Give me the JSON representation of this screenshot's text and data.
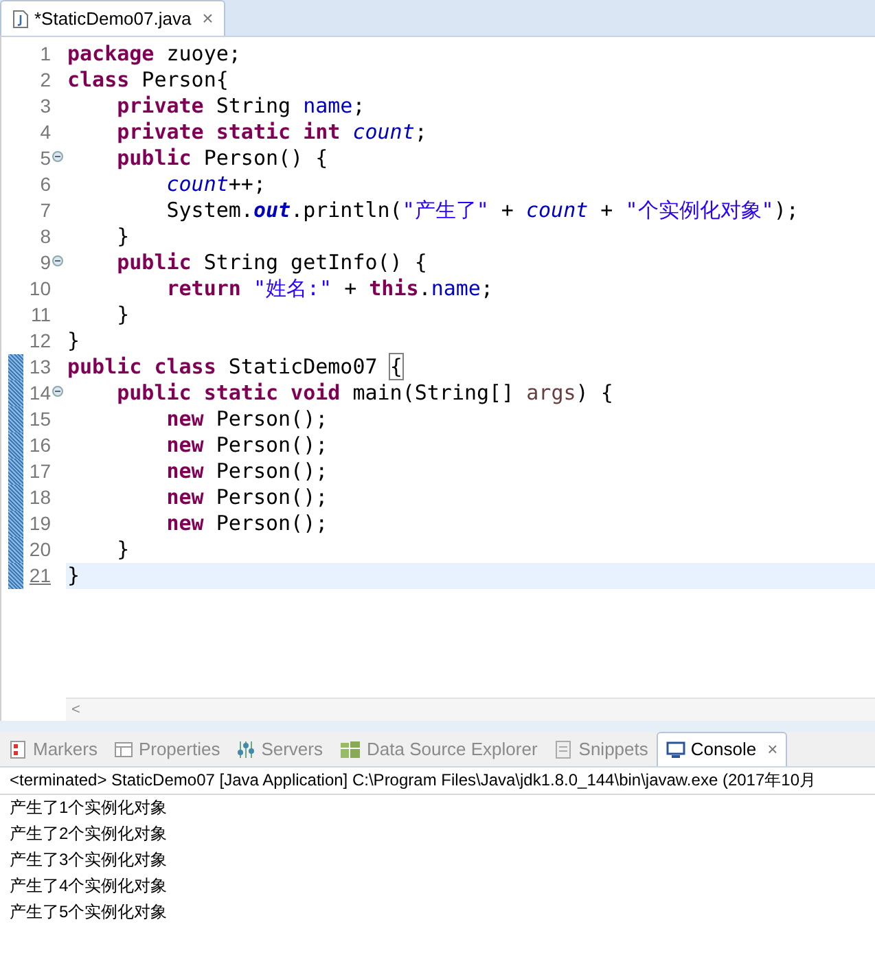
{
  "editor_tab": {
    "title": "*StaticDemo07.java",
    "close": "×"
  },
  "code_lines": [
    {
      "number": "1",
      "fold": false,
      "changed": false,
      "current": false,
      "tokens": [
        {
          "kind": "kw",
          "t": "package"
        },
        {
          "kind": "plain",
          "t": " zuoye;"
        }
      ]
    },
    {
      "number": "2",
      "fold": false,
      "changed": false,
      "current": false,
      "tokens": [
        {
          "kind": "kw",
          "t": "class"
        },
        {
          "kind": "plain",
          "t": " Person{"
        }
      ]
    },
    {
      "number": "3",
      "fold": false,
      "changed": false,
      "current": false,
      "tokens": [
        {
          "kind": "kw",
          "t": "    private"
        },
        {
          "kind": "plain",
          "t": " String "
        },
        {
          "kind": "field",
          "t": "name"
        },
        {
          "kind": "plain",
          "t": ";"
        }
      ]
    },
    {
      "number": "4",
      "fold": false,
      "changed": false,
      "current": false,
      "tokens": [
        {
          "kind": "kw",
          "t": "    private static int"
        },
        {
          "kind": "static",
          "t": " count"
        },
        {
          "kind": "plain",
          "t": ";"
        }
      ]
    },
    {
      "number": "5",
      "fold": true,
      "changed": false,
      "current": false,
      "tokens": [
        {
          "kind": "kw",
          "t": "    public"
        },
        {
          "kind": "plain",
          "t": " Person() {"
        }
      ]
    },
    {
      "number": "6",
      "fold": false,
      "changed": false,
      "current": false,
      "tokens": [
        {
          "kind": "static",
          "t": "        count"
        },
        {
          "kind": "plain",
          "t": "++;"
        }
      ]
    },
    {
      "number": "7",
      "fold": false,
      "changed": false,
      "current": false,
      "tokens": [
        {
          "kind": "plain",
          "t": "        System."
        },
        {
          "kind": "staticbold",
          "t": "out"
        },
        {
          "kind": "plain",
          "t": ".println("
        },
        {
          "kind": "string",
          "t": "\"产生了\""
        },
        {
          "kind": "plain",
          "t": " + "
        },
        {
          "kind": "static",
          "t": "count"
        },
        {
          "kind": "plain",
          "t": " + "
        },
        {
          "kind": "string",
          "t": "\"个实例化对象\""
        },
        {
          "kind": "plain",
          "t": ");"
        }
      ]
    },
    {
      "number": "8",
      "fold": false,
      "changed": false,
      "current": false,
      "tokens": [
        {
          "kind": "plain",
          "t": "    }"
        }
      ]
    },
    {
      "number": "9",
      "fold": true,
      "changed": false,
      "current": false,
      "tokens": [
        {
          "kind": "kw",
          "t": "    public"
        },
        {
          "kind": "plain",
          "t": " String getInfo() {"
        }
      ]
    },
    {
      "number": "10",
      "fold": false,
      "changed": false,
      "current": false,
      "tokens": [
        {
          "kind": "kw",
          "t": "        return"
        },
        {
          "kind": "string",
          "t": " \"姓名:\""
        },
        {
          "kind": "plain",
          "t": " + "
        },
        {
          "kind": "kw",
          "t": "this"
        },
        {
          "kind": "plain",
          "t": "."
        },
        {
          "kind": "field",
          "t": "name"
        },
        {
          "kind": "plain",
          "t": ";"
        }
      ]
    },
    {
      "number": "11",
      "fold": false,
      "changed": false,
      "current": false,
      "tokens": [
        {
          "kind": "plain",
          "t": "    }"
        }
      ]
    },
    {
      "number": "12",
      "fold": false,
      "changed": false,
      "current": false,
      "tokens": [
        {
          "kind": "plain",
          "t": "}"
        }
      ]
    },
    {
      "number": "13",
      "fold": false,
      "changed": true,
      "current": false,
      "tokens": [
        {
          "kind": "kw",
          "t": "public class"
        },
        {
          "kind": "plain",
          "t": " StaticDemo07 "
        },
        {
          "kind": "bracket",
          "t": "{"
        }
      ]
    },
    {
      "number": "14",
      "fold": true,
      "changed": true,
      "current": false,
      "tokens": [
        {
          "kind": "kw",
          "t": "    public static void"
        },
        {
          "kind": "plain",
          "t": " main(String[] "
        },
        {
          "kind": "param",
          "t": "args"
        },
        {
          "kind": "plain",
          "t": ") {"
        }
      ]
    },
    {
      "number": "15",
      "fold": false,
      "changed": true,
      "current": false,
      "tokens": [
        {
          "kind": "kw",
          "t": "        new"
        },
        {
          "kind": "plain",
          "t": " Person();"
        }
      ]
    },
    {
      "number": "16",
      "fold": false,
      "changed": true,
      "current": false,
      "tokens": [
        {
          "kind": "kw",
          "t": "        new"
        },
        {
          "kind": "plain",
          "t": " Person();"
        }
      ]
    },
    {
      "number": "17",
      "fold": false,
      "changed": true,
      "current": false,
      "tokens": [
        {
          "kind": "kw",
          "t": "        new"
        },
        {
          "kind": "plain",
          "t": " Person();"
        }
      ]
    },
    {
      "number": "18",
      "fold": false,
      "changed": true,
      "current": false,
      "tokens": [
        {
          "kind": "kw",
          "t": "        new"
        },
        {
          "kind": "plain",
          "t": " Person();"
        }
      ]
    },
    {
      "number": "19",
      "fold": false,
      "changed": true,
      "current": false,
      "tokens": [
        {
          "kind": "kw",
          "t": "        new"
        },
        {
          "kind": "plain",
          "t": " Person();"
        }
      ]
    },
    {
      "number": "20",
      "fold": false,
      "changed": true,
      "current": false,
      "tokens": [
        {
          "kind": "plain",
          "t": "    }"
        }
      ]
    },
    {
      "number": "21",
      "fold": false,
      "changed": true,
      "current": true,
      "tokens": [
        {
          "kind": "plain",
          "t": "}"
        }
      ]
    }
  ],
  "scrollbar": {
    "left_arrow": "<"
  },
  "panel_tabs": [
    {
      "label": "Markers",
      "kind": "markers",
      "selected": false
    },
    {
      "label": "Properties",
      "kind": "properties",
      "selected": false
    },
    {
      "label": "Servers",
      "kind": "servers",
      "selected": false
    },
    {
      "label": "Data Source Explorer",
      "kind": "datasource",
      "selected": false
    },
    {
      "label": "Snippets",
      "kind": "snippets",
      "selected": false
    },
    {
      "label": "Console",
      "kind": "console",
      "selected": true,
      "close": "×"
    }
  ],
  "console": {
    "header": "<terminated> StaticDemo07 [Java Application] C:\\Program Files\\Java\\jdk1.8.0_144\\bin\\javaw.exe (2017年10月",
    "output": [
      "产生了1个实例化对象",
      "产生了2个实例化对象",
      "产生了3个实例化对象",
      "产生了4个实例化对象",
      "产生了5个实例化对象"
    ]
  }
}
